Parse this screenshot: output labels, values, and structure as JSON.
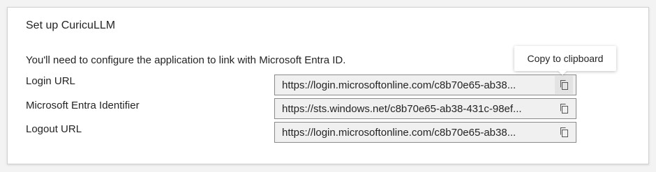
{
  "card": {
    "title": "Set up CuricuLLM",
    "description": "You'll need to configure the application to link with Microsoft Entra ID."
  },
  "fields": [
    {
      "label": "Login URL",
      "value": "https://login.microsoftonline.com/c8b70e65-ab38...",
      "copy_icon": "copy-icon"
    },
    {
      "label": "Microsoft Entra Identifier",
      "value": "https://sts.windows.net/c8b70e65-ab38-431c-98ef...",
      "copy_icon": "copy-icon"
    },
    {
      "label": "Logout URL",
      "value": "https://login.microsoftonline.com/c8b70e65-ab38...",
      "copy_icon": "copy-icon"
    }
  ],
  "tooltip": {
    "text": "Copy to clipboard"
  }
}
